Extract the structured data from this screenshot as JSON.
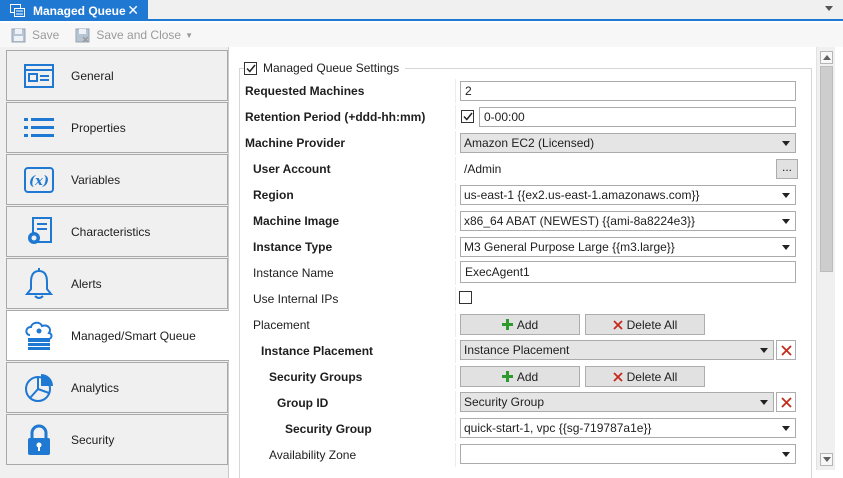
{
  "tab": {
    "title": "Managed Queue",
    "close_glyph": "✕"
  },
  "toolbar": {
    "save_label": "Save",
    "save_close_label": "Save and Close"
  },
  "nav": [
    {
      "label": "General",
      "icon": "general-form-icon"
    },
    {
      "label": "Properties",
      "icon": "list-icon"
    },
    {
      "label": "Variables",
      "icon": "variable-x-icon"
    },
    {
      "label": "Characteristics",
      "icon": "gear-document-icon"
    },
    {
      "label": "Alerts",
      "icon": "bell-icon"
    },
    {
      "label": "Managed/Smart Queue",
      "icon": "cloud-queue-icon"
    },
    {
      "label": "Analytics",
      "icon": "pie-chart-icon"
    },
    {
      "label": "Security",
      "icon": "lock-icon"
    }
  ],
  "settings": {
    "group_title": "Managed Queue Settings",
    "group_checked": true,
    "requested_machines": {
      "label": "Requested Machines",
      "value": "2"
    },
    "retention_period": {
      "label": "Retention Period (+ddd-hh:mm)",
      "checked": true,
      "value": "0-00:00"
    },
    "machine_provider": {
      "label": "Machine Provider",
      "value": "Amazon EC2 (Licensed)"
    },
    "user_account": {
      "label": "User Account",
      "value": "/Admin",
      "browse": "..."
    },
    "region": {
      "label": "Region",
      "value": "us-east-1 {{ex2.us-east-1.amazonaws.com}}"
    },
    "machine_image": {
      "label": "Machine Image",
      "value": "x86_64 ABAT (NEWEST) {{ami-8a8224e3}}"
    },
    "instance_type": {
      "label": "Instance Type",
      "value": "M3 General Purpose Large {{m3.large}}"
    },
    "instance_name": {
      "label": "Instance Name",
      "value": "ExecAgent1"
    },
    "use_internal_ips": {
      "label": "Use Internal IPs",
      "checked": false
    },
    "placement": {
      "label": "Placement",
      "add": "Add",
      "delete_all": "Delete All"
    },
    "instance_placement": {
      "label": "Instance Placement",
      "value": "Instance Placement"
    },
    "security_groups": {
      "label": "Security Groups",
      "add": "Add",
      "delete_all": "Delete All"
    },
    "group_id": {
      "label": "Group ID",
      "value": "Security Group"
    },
    "security_group": {
      "label": "Security Group",
      "value": "quick-start-1, vpc {{sg-719787a1e}}"
    },
    "availability_zone": {
      "label": "Availability Zone",
      "value": ""
    }
  },
  "colors": {
    "accent": "#1f78d1",
    "add_green": "#2e9a2e",
    "delete_red": "#c42b1c"
  }
}
